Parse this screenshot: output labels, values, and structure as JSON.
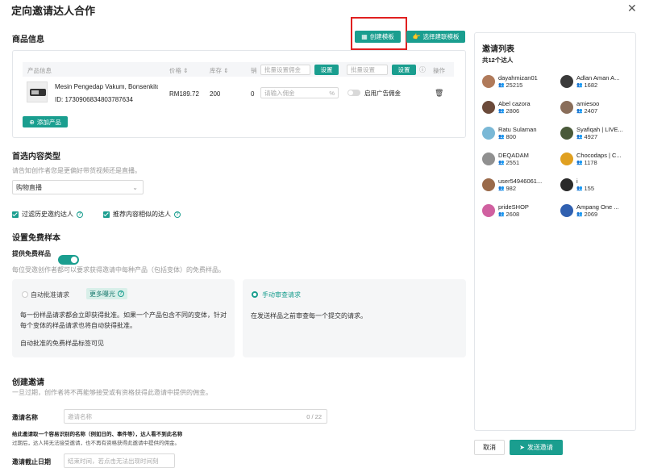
{
  "window": {
    "title": "定向邀请达人合作"
  },
  "product_section": {
    "title": "商品信息",
    "create_template": "创建模板",
    "select_template": "选择建联模板",
    "columns": {
      "product_info": "产品信息",
      "price": "价格",
      "stock": "库存",
      "sales": "销"
    },
    "batch_commission_placeholder": "批量设置佣金",
    "set_button": "设置",
    "batch_ad_placeholder": "批量设置",
    "set_button_2": "设置",
    "action_col": "操作",
    "product": {
      "name": "Mesin Pengedap Vakum, Bonsenkitch...",
      "id": "ID: 1730906834803787634",
      "price": "RM189.72",
      "stock": "200",
      "sales": "0",
      "commission_placeholder": "请输入佣金",
      "percent": "%",
      "ad_commission_label": "启用广告佣金"
    },
    "add_product": "添加产品"
  },
  "content_type": {
    "title": "首选内容类型",
    "desc": "请告知创作者您是更偏好带货视频还是直播。",
    "selected": "购物直播"
  },
  "filters": {
    "filter_history": "过滤历史邀约达人",
    "recommend_similar": "推荐内容相似的达人"
  },
  "free_sample": {
    "title": "设置免费样本",
    "offer_label": "提供免费样品",
    "desc": "每位受邀创作者都可以要求获得邀请中每种产品（包括变体）的免费样品。",
    "auto": {
      "label": "自动批准请求",
      "badge": "更多曝光",
      "desc": "每一份样品请求都会立即获得批准。如果一个产品包含不同的变体，针对每个变体的样品请求也将自动获得批准。",
      "note": "自动批准的免费样品标签可见"
    },
    "manual": {
      "label": "手动审查请求",
      "desc": "在发送样品之前审查每一个提交的请求。"
    }
  },
  "create_invite": {
    "title": "创建邀请",
    "desc": "一旦过期，创作者将不再能够接受或有资格获得此邀请中提供的佣金。",
    "name_label": "邀请名称",
    "name_placeholder": "邀请名称",
    "name_counter": "0 / 22",
    "hint_bold": "给此邀请取一个容易识别的名称（例如日的、事件等），达人看不到此名称",
    "hint": "过期后，达人将无法接受邀请，也不再有资格获得此邀请中提供的佣金。",
    "deadline_label": "邀请截止日期",
    "deadline_placeholder": "结束时间，若点击无法出现时间刻"
  },
  "invite_list": {
    "title": "邀请列表",
    "count": "共12个达人",
    "items": [
      {
        "name": "dayahmizan01",
        "followers": "25215",
        "color": "#b07a5a"
      },
      {
        "name": "Adlan Aman A...",
        "followers": "1682",
        "color": "#3a3a3a"
      },
      {
        "name": "Abel cazora",
        "followers": "2806",
        "color": "#6b4a3a"
      },
      {
        "name": "amiesoo",
        "followers": "2407",
        "color": "#8a6e5a"
      },
      {
        "name": "Ratu Sulaman",
        "followers": "800",
        "color": "#7ab8d6"
      },
      {
        "name": "Syafiqah | LIVE...",
        "followers": "4927",
        "color": "#4a5a3a"
      },
      {
        "name": "DEQADAM",
        "followers": "2551",
        "color": "#909090"
      },
      {
        "name": "Chocodaps | C...",
        "followers": "1178",
        "color": "#e0a020"
      },
      {
        "name": "user54946061...",
        "followers": "982",
        "color": "#9a6a4a"
      },
      {
        "name": "i",
        "followers": "155",
        "color": "#2a2a2a"
      },
      {
        "name": "prideSHOP",
        "followers": "2608",
        "color": "#d060a0"
      },
      {
        "name": "Ampang One ...",
        "followers": "2069",
        "color": "#3060b0"
      }
    ]
  },
  "footer": {
    "cancel": "取消",
    "send": "发送邀请"
  },
  "colors": {
    "accent": "#1a9e8f",
    "highlight": "#e02020"
  }
}
